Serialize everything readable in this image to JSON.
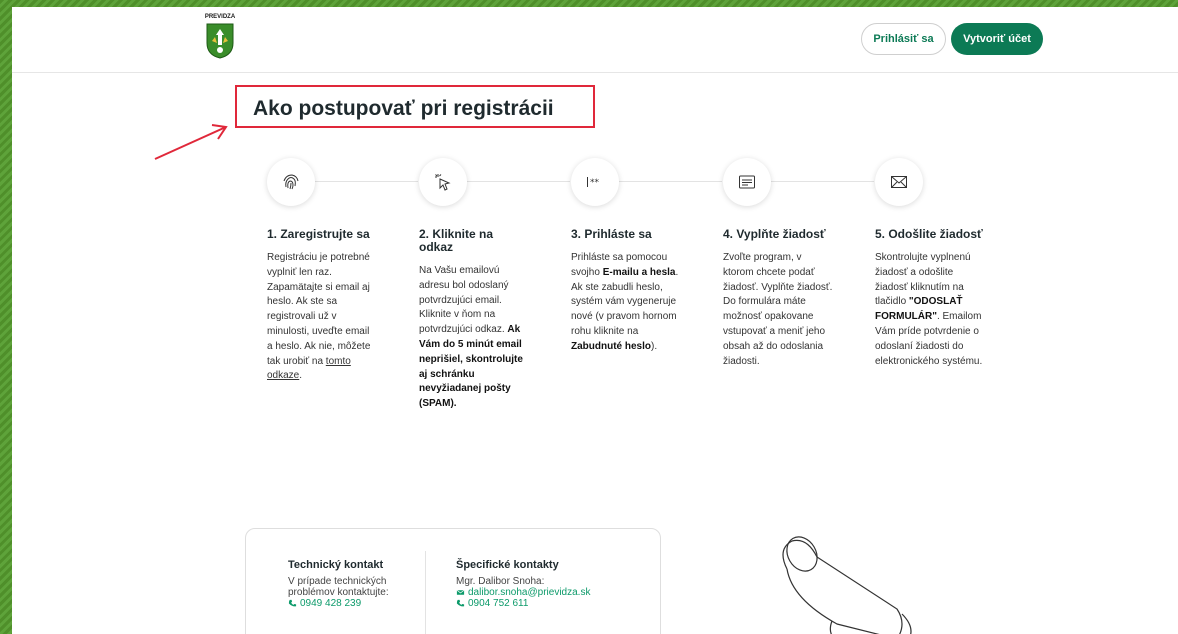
{
  "header": {
    "logo_text": "PREVIDZA",
    "login_label": "Prihlásiť sa",
    "create_label": "Vytvoriť účet"
  },
  "main": {
    "title": "Ako postupovať pri registrácii"
  },
  "steps": [
    {
      "icon": "fingerprint-icon",
      "title": "1. Zaregistrujte sa",
      "text_before": "Registráciu je potrebné vyplniť len raz. Zapamätajte si email aj heslo. Ak ste sa registrovali už v minulosti, uveďte email a heslo. Ak nie, môžete tak urobiť na ",
      "link": "tomto odkaze",
      "text_after": "."
    },
    {
      "icon": "cursor-click-icon",
      "title": "2. Kliknite na odkaz",
      "text": "Na Vašu emailovú adresu bol odoslaný potvrdzujúci email. Kliknite v ňom na potvrdzujúci odkaz.",
      "bold": "Ak Vám do 5 minút email neprišiel, skontrolujte aj schránku nevyžiadanej pošty (SPAM)."
    },
    {
      "icon": "password-icon",
      "title": "3. Prihláste sa",
      "t1": "Prihláste sa pomocou svojho ",
      "b1": "E-mailu a hesla",
      "t2": ". Ak ste zabudli heslo, systém vám vygeneruje nové (v pravom hornom rohu kliknite na ",
      "b2": "Zabudnuté heslo",
      "t3": ")."
    },
    {
      "icon": "form-icon",
      "title": "4. Vyplňte žiadosť",
      "text": "Zvoľte program, v ktorom chcete podať žiadosť. Vyplňte žiadosť. Do formulára máte možnosť opakovane vstupovať a meniť jeho obsah až do odoslania žiadosti."
    },
    {
      "icon": "envelope-icon",
      "title": "5. Odošlite žiadosť",
      "t1": "Skontrolujte vyplnenú žiadosť a odošlite žiadosť kliknutím na tlačidlo ",
      "b1": "\"ODOSLAŤ FORMULÁR\"",
      "t2": ". Emailom Vám príde potvrdenie o odoslaní žiadosti do elektronického systému."
    }
  ],
  "contacts": {
    "tech_title": "Technický kontakt",
    "tech_text": "V prípade technických problémov kontaktujte:",
    "tech_phone": "0949 428 239",
    "spec_title": "Špecifické kontakty",
    "spec_name": "Mgr. Dalibor Snoha:",
    "spec_email": "dalibor.snoha@prievidza.sk",
    "spec_phone": "0904 752 611"
  },
  "colors": {
    "brand_green": "#0c7a55",
    "link_green": "#0c9a6a",
    "highlight_red": "#e0283a"
  }
}
